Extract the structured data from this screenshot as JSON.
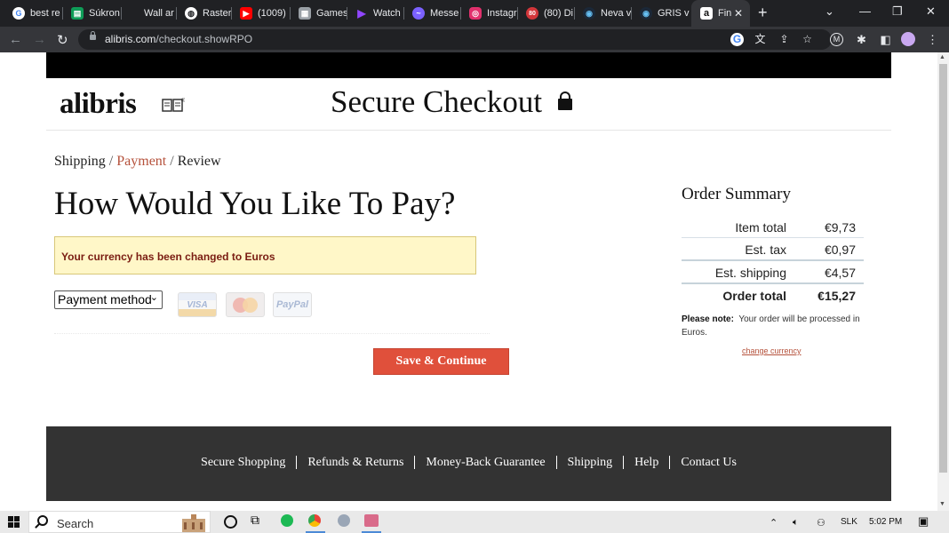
{
  "browser": {
    "tabs": [
      {
        "title": "best re",
        "icon": "google-icon",
        "color": "#ffffff"
      },
      {
        "title": "Súkron",
        "icon": "sheets-icon",
        "color": "#0f9d58"
      },
      {
        "title": "Wall ar",
        "icon": "blank-icon",
        "color": "#202124"
      },
      {
        "title": "Rasterl",
        "icon": "globe-icon",
        "color": "#ffffff"
      },
      {
        "title": "(1009)",
        "icon": "youtube-icon",
        "color": "#ff0000"
      },
      {
        "title": "Games",
        "icon": "games-icon",
        "color": "#9aa0a6"
      },
      {
        "title": "Watch",
        "icon": "play-icon",
        "color": "#9146ff"
      },
      {
        "title": "Messe",
        "icon": "messenger-icon",
        "color": "#7b61ff"
      },
      {
        "title": "Instagr",
        "icon": "instagram-icon",
        "color": "#e1306c"
      },
      {
        "title": "(80) Di",
        "icon": "badge-icon",
        "color": "#d2363a"
      },
      {
        "title": "Neva v",
        "icon": "steam-icon",
        "color": "#66c0f4"
      },
      {
        "title": "GRIS v",
        "icon": "steam-icon",
        "color": "#66c0f4"
      },
      {
        "title": "Fin",
        "icon": "amazon-icon",
        "color": "#ffffff",
        "active": true
      }
    ],
    "url_domain": "alibris.com",
    "url_path": "/checkout.showRPO"
  },
  "header": {
    "logo_text": "alibris",
    "logo_mark": "®",
    "title": "Secure Checkout"
  },
  "breadcrumb": {
    "step1": "Shipping",
    "sep": "/",
    "step2": "Payment",
    "step3": "Review"
  },
  "main": {
    "heading": "How Would You Like To Pay?",
    "notice": "Your currency has been changed to Euros",
    "payment_select": "Payment method",
    "cards": {
      "visa": "VISA",
      "paypal": "PayPal"
    },
    "save_button": "Save & Continue"
  },
  "summary": {
    "title": "Order Summary",
    "rows": [
      {
        "label": "Item total",
        "value": "€9,73"
      },
      {
        "label": "Est. tax",
        "value": "€0,97"
      },
      {
        "label": "Est. shipping",
        "value": "€4,57"
      },
      {
        "label": "Order total",
        "value": "€15,27"
      }
    ],
    "note_label": "Please note:",
    "note_text": "Your order will be processed in Euros.",
    "change_link": "change currency"
  },
  "footer": {
    "links": [
      "Secure Shopping",
      "Refunds & Returns",
      "Money-Back Guarantee",
      "Shipping",
      "Help",
      "Contact Us"
    ]
  },
  "taskbar": {
    "search": "Search",
    "language": "SLK",
    "time": "5:02 PM"
  },
  "colors": {
    "accent": "#e0503b",
    "link": "#b5513b",
    "notice_bg": "#fff7c8",
    "footer_bg": "#333333"
  }
}
